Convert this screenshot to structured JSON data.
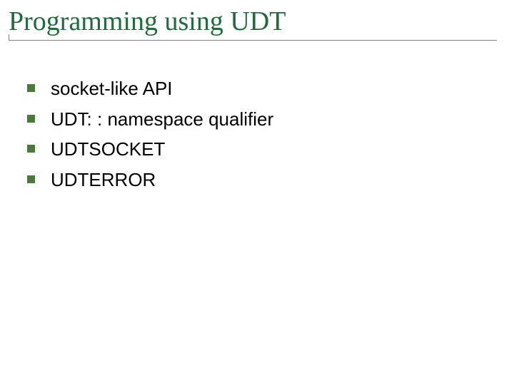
{
  "title": "Programming using UDT",
  "bullets": [
    "socket-like API",
    "UDT: : namespace qualifier",
    "UDTSOCKET",
    "UDTERROR"
  ],
  "colors": {
    "title": "#1f6b3a",
    "bullet": "#4a7a3a",
    "rule": "#808080"
  }
}
